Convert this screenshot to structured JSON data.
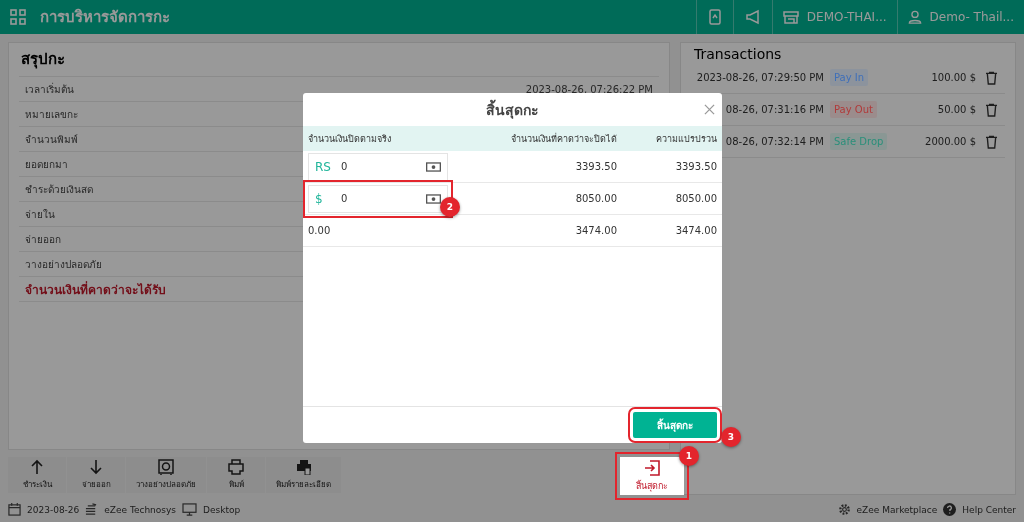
{
  "header": {
    "title": "การบริหารจัดการกะ",
    "property": "DEMO-THAI...",
    "user": "Demo- Thail..."
  },
  "summary": {
    "title": "สรุปกะ",
    "rows": [
      {
        "label": "เวลาเริ่มต้น",
        "value": "2023-08-26, 07:26:22 PM",
        "kind": "normal"
      },
      {
        "label": "หมายเลขกะ",
        "kind": "normal"
      },
      {
        "label": "จำนวนพิมพ์",
        "kind": "normal"
      },
      {
        "label": "ยอดยกมา",
        "kind": "normal"
      },
      {
        "label": "ชำระด้วยเงินสด",
        "kind": "normal"
      },
      {
        "label": "จ่ายใน",
        "kind": "normal"
      },
      {
        "label": "จ่ายออก",
        "kind": "normal"
      },
      {
        "label": "วางอย่างปลอดภัย",
        "kind": "normal"
      },
      {
        "label": "จำนวนเงินที่คาดว่าจะได้รับ",
        "kind": "total"
      }
    ]
  },
  "transactions": {
    "title": "Transactions",
    "rows": [
      {
        "time": "2023-08-26, 07:29:50 PM",
        "type": "Pay In",
        "color": "#3f6fb8",
        "amount": "100.00 $"
      },
      {
        "time": "08-26, 07:31:16 PM",
        "type": "Pay Out",
        "color": "#b03a3a",
        "amount": "50.00 $"
      },
      {
        "time": "08-26, 07:32:14 PM",
        "type": "Safe Drop",
        "color": "#2a8f7a",
        "amount": "2000.00 $"
      }
    ]
  },
  "toolbar": {
    "buttons": [
      {
        "label": "ชำระเงิน",
        "kind": "up"
      },
      {
        "label": "จ่ายออก",
        "kind": "down"
      },
      {
        "label": "วางอย่างปลอดภัย",
        "kind": "safe"
      },
      {
        "label": "พิมพ์",
        "kind": "print"
      },
      {
        "label": "พิมพ์รายละเอียด",
        "kind": "print-detail"
      }
    ],
    "end_shift": "สิ้นสุดกะ"
  },
  "status_bar": {
    "date": "2023-08-26",
    "company": "eZee Technosys",
    "device": "Desktop",
    "marketplace": "eZee Marketplace",
    "help": "Help Center"
  },
  "modal": {
    "title": "สิ้นสุดกะ",
    "columns": [
      "จำนวนเงินปิดตามจริง",
      "จำนวนเงินที่คาดว่าจะปิดได้",
      "ความแปรปรวน"
    ],
    "rows": [
      {
        "kind": "input",
        "currency": "RS",
        "value": "0",
        "expected": "3393.50",
        "variance": "3393.50"
      },
      {
        "kind": "input",
        "currency": "$",
        "value": "0",
        "expected": "8050.00",
        "variance": "8050.00"
      },
      {
        "kind": "total",
        "actual": "0.00",
        "expected": "3474.00",
        "variance": "3474.00"
      }
    ],
    "button": "สิ้นสุดกะ"
  },
  "annotations": [
    {
      "number": "1"
    },
    {
      "number": "2"
    },
    {
      "number": "3"
    }
  ]
}
